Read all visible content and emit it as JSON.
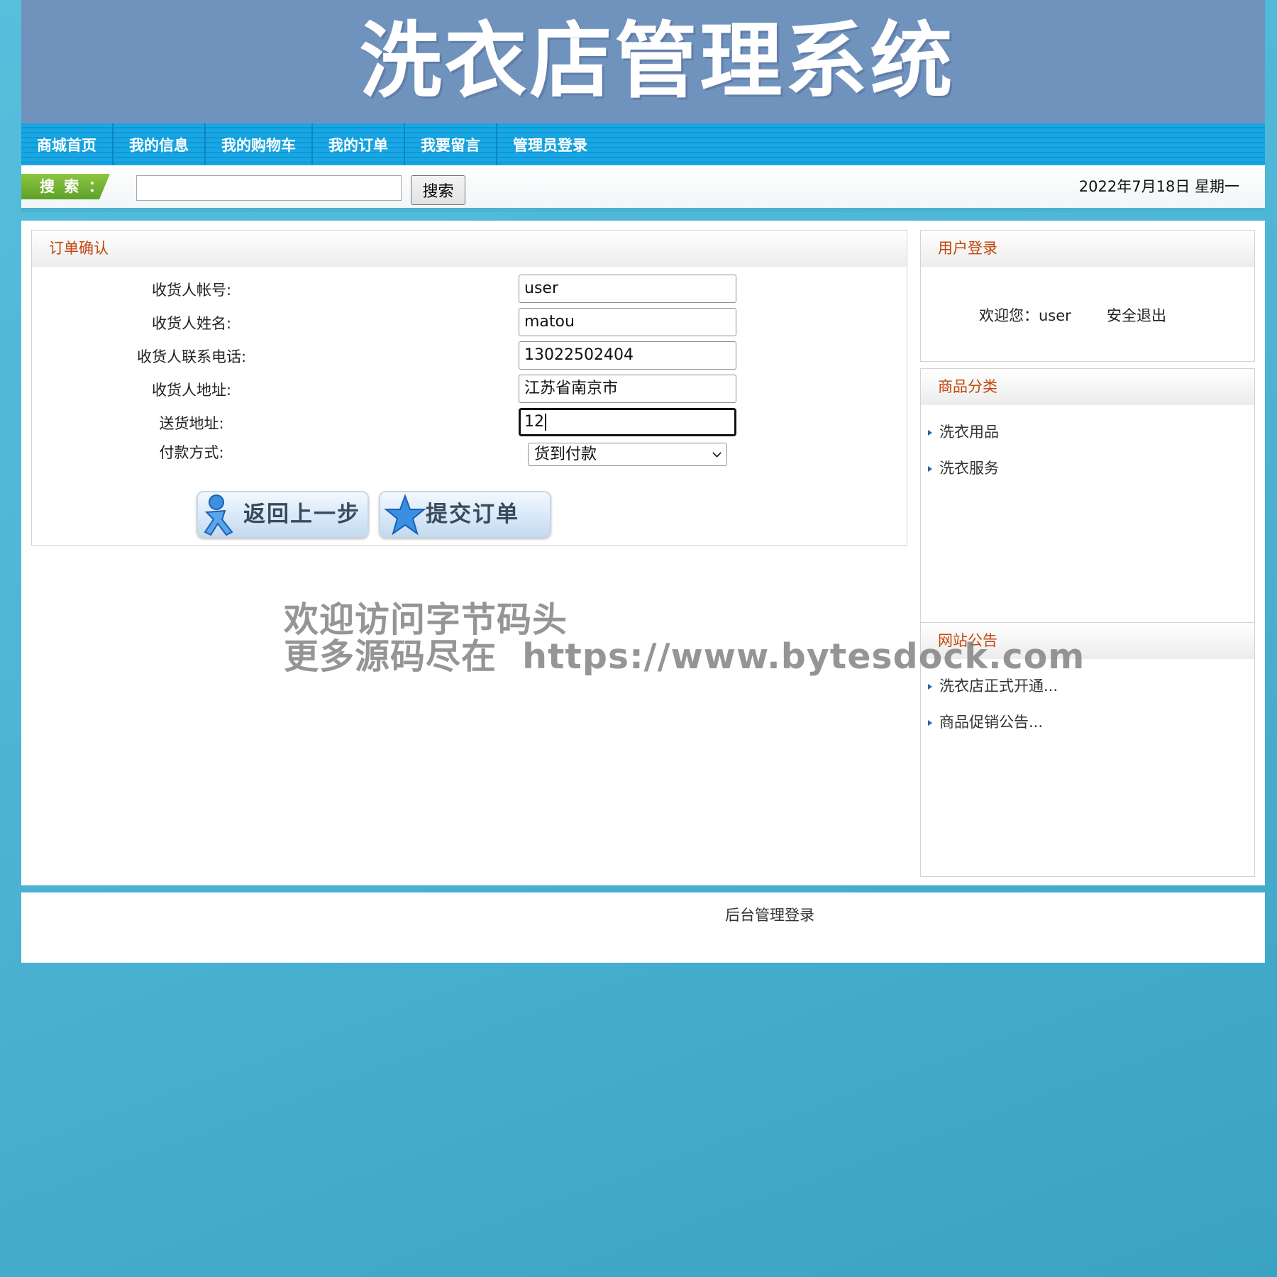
{
  "header": {
    "title": "洗衣店管理系统"
  },
  "nav": {
    "items": [
      "商城首页",
      "我的信息",
      "我的购物车",
      "我的订单",
      "我要留言",
      "管理员登录"
    ]
  },
  "search": {
    "tag": "搜 索 ：",
    "value": "",
    "button": "搜索",
    "date": "2022年7月18日 星期一"
  },
  "order": {
    "title": "订单确认",
    "fields": [
      {
        "label": "收货人帐号:",
        "value": "user"
      },
      {
        "label": "收货人姓名:",
        "value": "matou"
      },
      {
        "label": "收货人联系电话:",
        "value": "13022502404"
      },
      {
        "label": "收货人地址:",
        "value": "江苏省南京市"
      },
      {
        "label": "送货地址:",
        "value": "12"
      }
    ],
    "payment_label": "付款方式:",
    "payment_value": "货到付款",
    "back_button": "返回上一步",
    "submit_button": "提交订单"
  },
  "sidebar": {
    "login_title": "用户登录",
    "welcome": "欢迎您：user",
    "logout": "安全退出",
    "category_title": "商品分类",
    "categories": [
      "洗衣用品",
      "洗衣服务"
    ],
    "notice_title": "网站公告",
    "notices": [
      "洗衣店正式开通...",
      "商品促销公告..."
    ]
  },
  "footer": {
    "link": "后台管理登录"
  },
  "watermark": {
    "line1": "欢迎访问字节码头",
    "line2": "更多源码尽在  https://www.bytesdock.com"
  }
}
